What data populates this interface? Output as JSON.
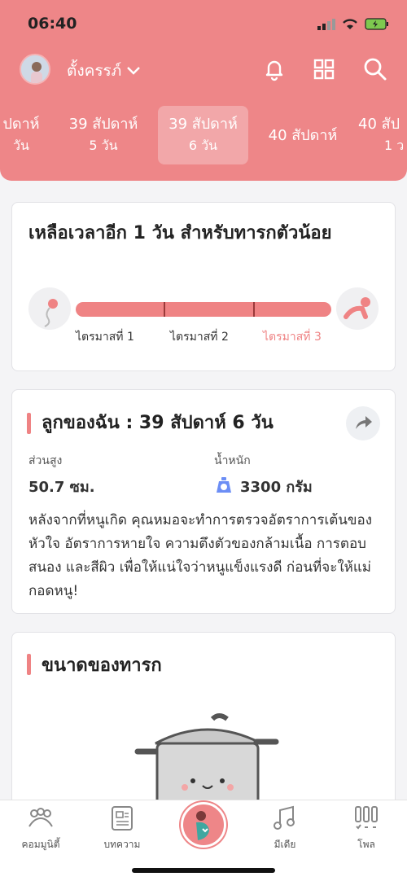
{
  "status": {
    "time": "06:40"
  },
  "profile": {
    "name": "ตั้งครรภ์"
  },
  "weeks": [
    {
      "l1": "ปดาห์",
      "l2": "วัน"
    },
    {
      "l1": "39 สัปดาห์",
      "l2": "5 วัน"
    },
    {
      "l1": "39 สัปดาห์",
      "l2": "6 วัน"
    },
    {
      "l1": "40 สัปดาห์",
      "l2": ""
    },
    {
      "l1": "40 สัป",
      "l2": "1 ว"
    }
  ],
  "countdown": {
    "title": "เหลือเวลาอีก 1 วัน สำหรับทารกตัวน้อย",
    "trimesters": [
      "ไตรมาสที่ 1",
      "ไตรมาสที่ 2",
      "ไตรมาสที่ 3"
    ],
    "progress": 1.0
  },
  "baby": {
    "title": "ลูกของฉัน : 39 สัปดาห์ 6  วัน",
    "height_label": "ส่วนสูง",
    "height_value": "50.7 ซม.",
    "weight_label": "น้ำหนัก",
    "weight_value": "3300 กรัม",
    "description": "หลังจากที่หนูเกิด คุณหมอจะทำการตรวจอัตราการเต้นของหัวใจ อัตราการหายใจ ความตึงตัวของกล้ามเนื้อ การตอบสนอง และสีผิว เพื่อให้แน่ใจว่าหนูแข็งแรงดี ก่อนที่จะให้แม่กอดหนู!"
  },
  "size": {
    "title": "ขนาดของทารก"
  },
  "nav": [
    {
      "label": "คอมมูนิตี้"
    },
    {
      "label": "บทความ"
    },
    {
      "label": ""
    },
    {
      "label": "มีเดีย"
    },
    {
      "label": "โพล"
    }
  ],
  "colors": {
    "brand": "#ee8688",
    "accent": "#ef8384"
  }
}
